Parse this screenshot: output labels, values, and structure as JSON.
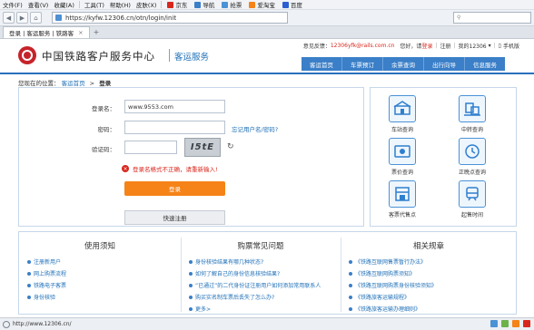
{
  "browser": {
    "menu": [
      "文件(F)",
      "查看(V)",
      "收藏(A)",
      "工具(T)",
      "帮助(H)",
      "皮肤(X)"
    ],
    "favorites": [
      "京东",
      "导航",
      "抢票",
      "爱淘宝",
      "百度"
    ],
    "address": "https://kyfw.12306.cn/otn/login/init",
    "tab_title": "登录 | 客运服务 | 铁路客",
    "status_url": "http://www.12306.cn/"
  },
  "header": {
    "site_title": "中国铁路客户服务中心",
    "site_subtitle": "客运服务",
    "feedback_prefix": "意见反馈：",
    "feedback_email": "12306yfk@rails.com.cn",
    "greeting": "您好，请",
    "login_link": "登录",
    "register_link": "注册",
    "my_12306": "我的12306",
    "mobile": "手机版",
    "nav": [
      "客运首页",
      "车票预订",
      "余票查询",
      "出行向导",
      "信息服务"
    ]
  },
  "breadcrumb": {
    "prefix": "您现在的位置：",
    "home": "客运首页",
    "separator": ">",
    "current": "登录"
  },
  "login": {
    "username_label": "登录名：",
    "username_value": "www.9553.com",
    "password_label": "密码：",
    "password_value": "",
    "forgot_link": "忘记用户名/密码?",
    "captcha_label": "验证码：",
    "captcha_value": "",
    "captcha_image_text": "I5tE",
    "error_message": "登录名格式不正确，请重新输入!",
    "login_button": "登录",
    "register_button": "快速注册"
  },
  "services": [
    {
      "label": "车站查询",
      "icon": "train-station-icon"
    },
    {
      "label": "中转查询",
      "icon": "transfer-icon"
    },
    {
      "label": "票价查询",
      "icon": "ticket-price-icon"
    },
    {
      "label": "正晚点查询",
      "icon": "clock-icon"
    },
    {
      "label": "客票代售点",
      "icon": "agency-icon"
    },
    {
      "label": "起售时间",
      "icon": "start-time-icon"
    }
  ],
  "help": {
    "columns": [
      {
        "title": "使用须知",
        "items": [
          "注册新用户",
          "网上购票流程",
          "铁路电子客票",
          "身份核验"
        ]
      },
      {
        "title": "购票常见问题",
        "items": [
          "身份核验结果有哪几种状态?",
          "如何了解自己的身份信息核验结果?",
          "“已通过”的二代身份证注册用户如何添加常用联系人",
          "购买实名制车票后丢失了怎么办?",
          "更多>"
        ]
      },
      {
        "title": "相关规章",
        "items": [
          "《铁路互联网售票暂行办法》",
          "《铁路互联网购票须知》",
          "《铁路互联网购票身份核验须知》",
          "《铁路旅客运输规程》",
          "《铁路旅客运输办理细则》"
        ]
      }
    ]
  },
  "colors": {
    "brand_blue": "#3a7fc8",
    "link_blue": "#1e6fb7",
    "login_orange": "#f58318",
    "error_red": "#d9261c",
    "logo_red": "#c5242b"
  }
}
